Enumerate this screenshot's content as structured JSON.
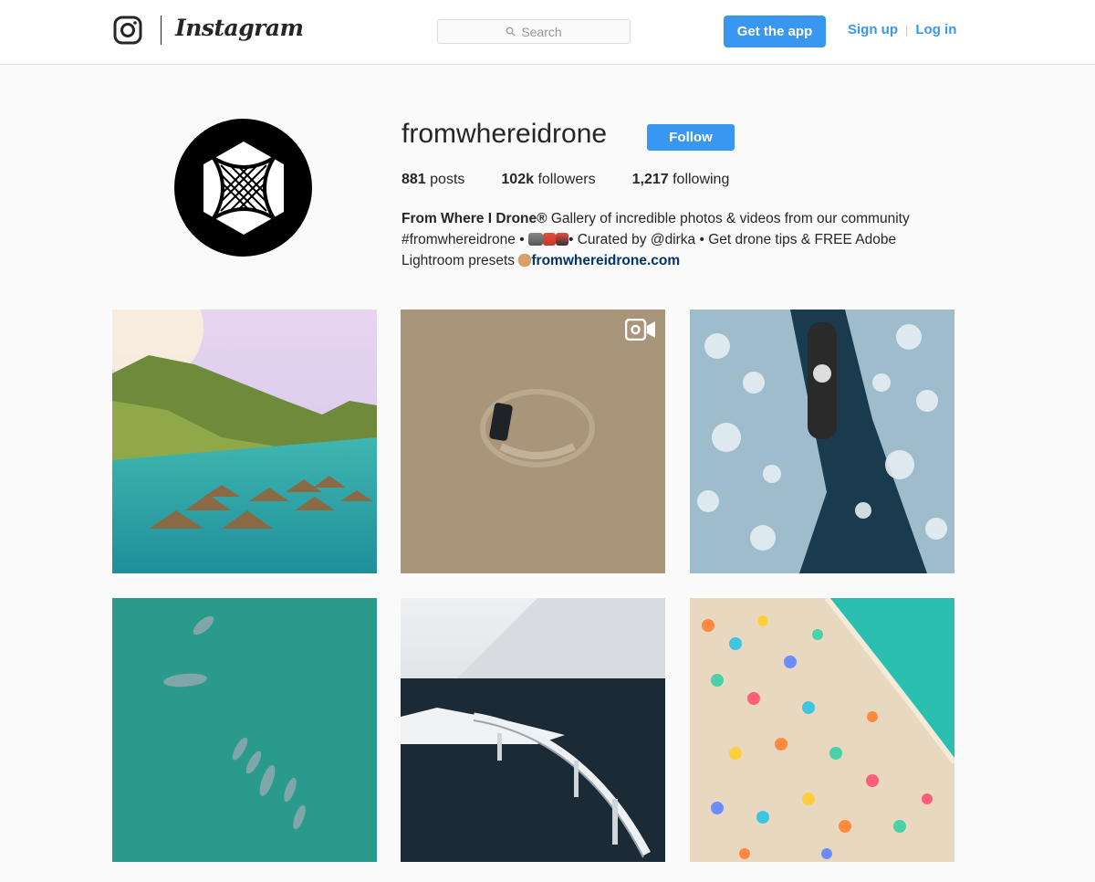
{
  "header": {
    "brand": "Instagram",
    "search_placeholder": "Search",
    "get_app_label": "Get the app",
    "signup_label": "Sign up",
    "separator": "|",
    "login_label": "Log in",
    "accent_color": "#3897f0"
  },
  "profile": {
    "username": "fromwhereidrone",
    "follow_label": "Follow",
    "posts_count": "881",
    "posts_label": "posts",
    "followers_count": "102k",
    "followers_label": "followers",
    "following_count": "1,217",
    "following_label": "following",
    "bio": {
      "name": "From Where I Drone®",
      "line1_rest": " Gallery of incredible photos & videos from our community",
      "hashtag": "#fromwhereidrone •",
      "line2_rest": "• Curated by @dirka • Get drone tips & FREE Adobe",
      "line3_start": "Lightroom presets ",
      "link": "fromwhereidrone.com"
    }
  },
  "posts": [
    {
      "subject": "overwater-bungalows",
      "is_video": false
    },
    {
      "subject": "car-in-desert",
      "is_video": true
    },
    {
      "subject": "ship-in-ice",
      "is_video": false
    },
    {
      "subject": "whales-turquoise",
      "is_video": false
    },
    {
      "subject": "bridge-snow",
      "is_video": false
    },
    {
      "subject": "beach-umbrellas",
      "is_video": false
    }
  ]
}
